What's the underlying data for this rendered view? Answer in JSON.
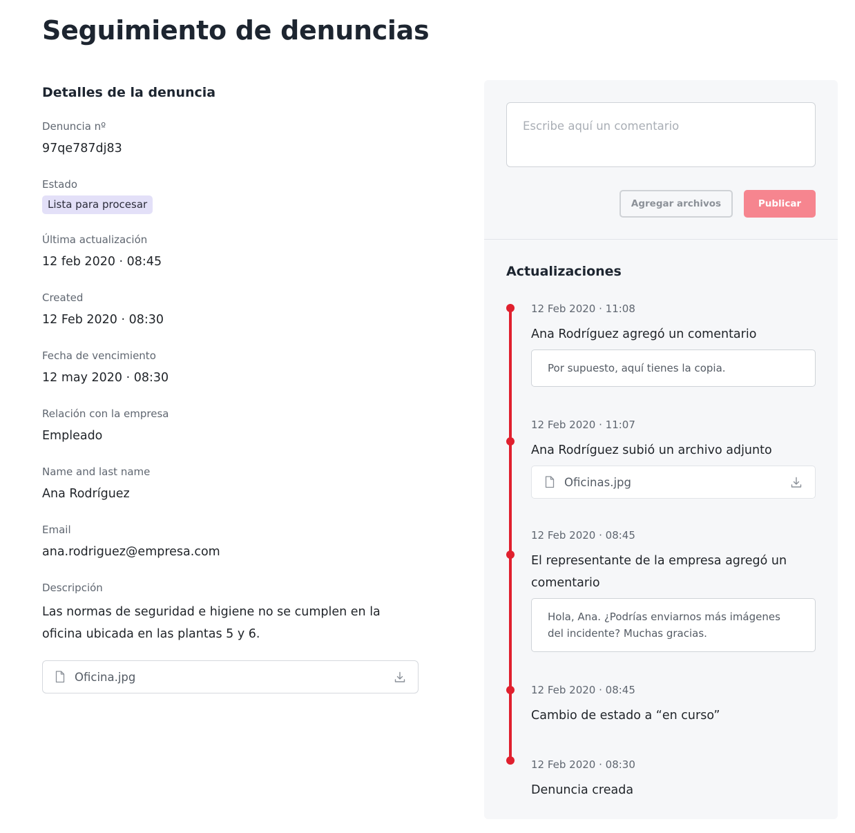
{
  "page": {
    "title": "Seguimiento de denuncias"
  },
  "details": {
    "section_title": "Detalles de la denuncia",
    "fields": {
      "number": {
        "label": "Denuncia nº",
        "value": "97qe787dj83"
      },
      "status": {
        "label": "Estado",
        "value": "Lista para procesar"
      },
      "last_update": {
        "label": "Última actualización",
        "value": "12 feb 2020 · 08:45"
      },
      "created": {
        "label": "Created",
        "value": "12 Feb 2020 · 08:30"
      },
      "due_date": {
        "label": "Fecha de vencimiento",
        "value": "12 may 2020 · 08:30"
      },
      "relation": {
        "label": "Relación con la empresa",
        "value": "Empleado"
      },
      "name": {
        "label": "Name and last name",
        "value": "Ana Rodríguez"
      },
      "email": {
        "label": "Email",
        "value": "ana.rodriguez@empresa.com"
      },
      "description": {
        "label": "Descripción",
        "value": "Las normas de seguridad e higiene no se cumplen en la oficina ubicada en las plantas 5 y 6."
      }
    },
    "attachment": {
      "file_name": "Oficina.jpg",
      "icon": "file-icon",
      "action_icon": "download-icon"
    }
  },
  "composer": {
    "placeholder": "Escribe aquí un comentario",
    "add_files_label": "Agregar archivos",
    "publish_label": "Publicar"
  },
  "updates": {
    "title": "Actualizaciones",
    "entries": [
      {
        "date": "12 Feb 2020 · 11:08",
        "text": "Ana Rodríguez agregó un comentario",
        "comment": "Por supuesto, aquí tienes la copia."
      },
      {
        "date": "12 Feb 2020 · 11:07",
        "text": "Ana Rodríguez subió un archivo adjunto",
        "file_name": "Oficinas.jpg"
      },
      {
        "date": "12 Feb 2020 · 08:45",
        "text": "El representante de la empresa agregó un comentario",
        "comment": "Hola, Ana. ¿Podrías enviarnos más imágenes del incidente? Muchas gracias."
      },
      {
        "date": "12 Feb 2020 · 08:45",
        "text": "Cambio de estado a “en curso”"
      },
      {
        "date": "12 Feb 2020 · 08:30",
        "text": "Denuncia creada"
      }
    ]
  },
  "colors": {
    "timeline": "#e0202e",
    "publish_button": "#f6858f",
    "status_badge_bg": "#e3e0f8",
    "panel_bg": "#f6f7f9"
  }
}
